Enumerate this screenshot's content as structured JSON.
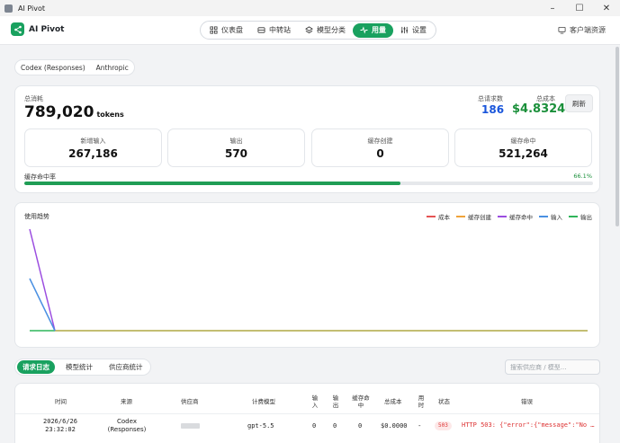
{
  "window": {
    "title": "AI Pivot",
    "minimize": "–",
    "maximize": "☐",
    "close": "✕"
  },
  "brand": {
    "name": "AI Pivot"
  },
  "nav": [
    {
      "label": "仪表盘"
    },
    {
      "label": "中转站"
    },
    {
      "label": "模型分类"
    },
    {
      "label": "用量"
    },
    {
      "label": "设置"
    }
  ],
  "customer_label": "客户端资源",
  "provider_tabs": [
    "Codex (Responses)",
    "Anthropic"
  ],
  "summary": {
    "total_label": "总消耗",
    "total_value": "789,020",
    "total_unit": "tokens",
    "requests_label": "总请求数",
    "requests_value": "186",
    "cost_label": "总成本",
    "cost_value": "$4.8324",
    "refresh_label": "刷新",
    "stats": [
      {
        "label": "新增输入",
        "value": "267,186"
      },
      {
        "label": "输出",
        "value": "570"
      },
      {
        "label": "缓存创建",
        "value": "0"
      },
      {
        "label": "缓存命中",
        "value": "521,264"
      }
    ],
    "hit_label": "缓存命中率",
    "hit_percent_text": "66.1%",
    "hit_fraction": 0.661
  },
  "trend": {
    "title": "使用趋势",
    "legend": [
      "成本",
      "缓存创建",
      "缓存命中",
      "输入",
      "输出"
    ],
    "colors": {
      "cost": "#e55353",
      "cache_create": "#f0a33a",
      "cache_hit": "#9b4de0",
      "input": "#4a90e2",
      "output": "#2fb55a"
    }
  },
  "log_tabs": [
    "请求日志",
    "模型统计",
    "供应商统计"
  ],
  "search": {
    "placeholder": "搜索供应商 / 模型..."
  },
  "table": {
    "headers": {
      "time": "时间",
      "source": "来源",
      "provider": "供应商",
      "model": "计费模型",
      "input": "输入",
      "output": "输出",
      "cache_hit": "缓存命中",
      "cost": "总成本",
      "duration": "用时",
      "status": "状态",
      "error": "错误"
    },
    "rows": [
      {
        "date": "2026/6/26",
        "time": "23:32:02",
        "source_line1": "Codex",
        "source_line2": "(Responses)",
        "model": "gpt-5.5",
        "input": "0",
        "output": "0",
        "cache_hit": "0",
        "cost": "$0.0000",
        "duration": "-",
        "status": "503",
        "error": "HTTP 503: {\"error\":{\"message\":\"No available...\"}}"
      }
    ]
  }
}
